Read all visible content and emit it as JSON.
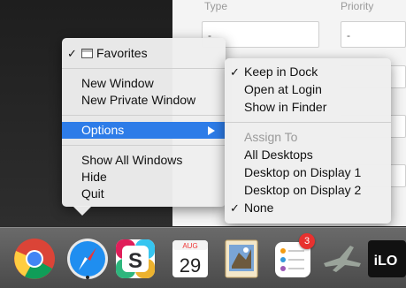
{
  "background_form": {
    "type_label": "Type",
    "priority_label": "Priority",
    "type_value": "-",
    "priority_value": "-"
  },
  "main_menu": {
    "favorites": "Favorites",
    "new_window": "New Window",
    "new_private_window": "New Private Window",
    "options": "Options",
    "show_all_windows": "Show All Windows",
    "hide": "Hide",
    "quit": "Quit"
  },
  "options_submenu": {
    "keep_in_dock": "Keep in Dock",
    "open_at_login": "Open at Login",
    "show_in_finder": "Show in Finder",
    "assign_to": "Assign To",
    "all_desktops": "All Desktops",
    "desktop_display_1": "Desktop on Display 1",
    "desktop_display_2": "Desktop on Display 2",
    "none": "None"
  },
  "checkmark": "✓",
  "dock": {
    "calendar_month": "AUG",
    "calendar_day": "29",
    "reminders_badge": "3",
    "slack_letter": "S",
    "last_app_text": "iLO"
  },
  "colors": {
    "highlight": "#2d7ce8",
    "badge": "#e8312f"
  }
}
